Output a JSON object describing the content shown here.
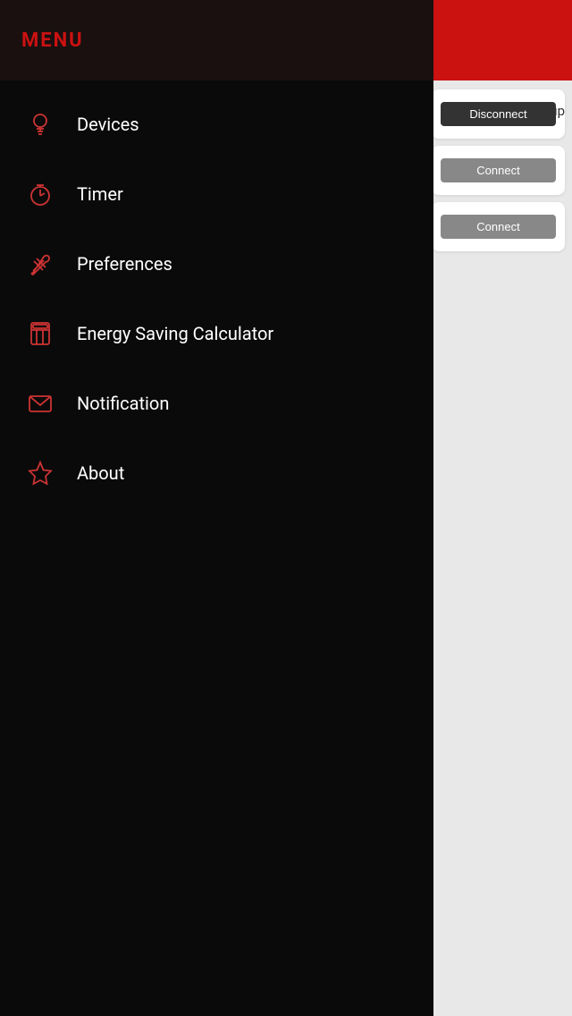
{
  "menu": {
    "title": "MENU",
    "items": [
      {
        "id": "devices",
        "label": "Devices",
        "icon": "lightbulb-icon"
      },
      {
        "id": "timer",
        "label": "Timer",
        "icon": "timer-icon"
      },
      {
        "id": "preferences",
        "label": "Preferences",
        "icon": "preferences-icon"
      },
      {
        "id": "energy-saving-calculator",
        "label": "Energy Saving Calculator",
        "icon": "calculator-icon"
      },
      {
        "id": "notification",
        "label": "Notification",
        "icon": "notification-icon"
      },
      {
        "id": "about",
        "label": "About",
        "icon": "about-icon"
      }
    ]
  },
  "right_panel": {
    "group_label": "oup",
    "cards": [
      {
        "id": "card1",
        "button_label": "Disconnect",
        "button_type": "disconnect"
      },
      {
        "id": "card2",
        "button_label": "Connect",
        "button_type": "connect"
      },
      {
        "id": "card3",
        "button_label": "Connect",
        "button_type": "connect"
      }
    ]
  },
  "colors": {
    "accent": "#cc1111",
    "menu_bg": "#0a0a0a",
    "header_bg": "#1a1010"
  }
}
